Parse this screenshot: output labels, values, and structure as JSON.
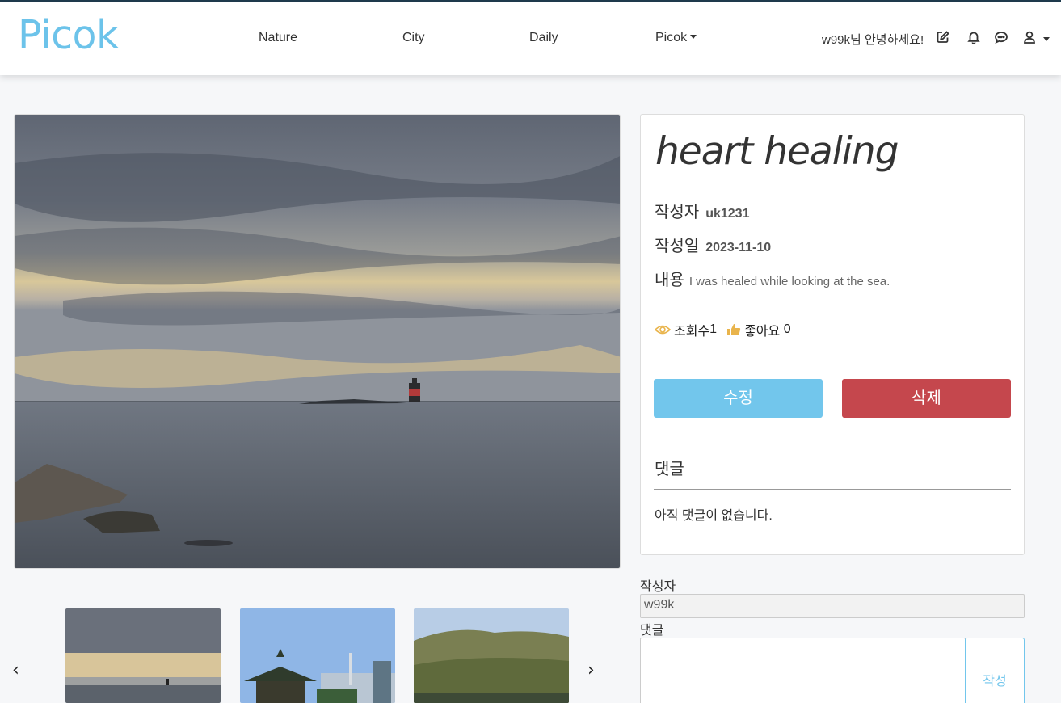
{
  "header": {
    "logo": "Picok",
    "nav": [
      "Nature",
      "City",
      "Daily",
      "Picok"
    ],
    "greeting": "w99k님 안녕하세요!",
    "icons": [
      "edit-icon",
      "bell-icon",
      "chat-icon",
      "user-icon"
    ]
  },
  "post": {
    "title": "heart healing",
    "author_label": "작성자",
    "author": "uk1231",
    "date_label": "작성일",
    "date": "2023-11-10",
    "content_label": "내용",
    "content": "I was healed while looking at the sea.",
    "views_label": "조회수",
    "views": "1",
    "likes_label": "좋아요",
    "likes": "0",
    "edit_button": "수정",
    "delete_button": "삭제",
    "comments_heading": "댓글",
    "no_comments": "아직 댓글이 없습니다."
  },
  "comment_form": {
    "author_label": "작성자",
    "author_value": "w99k",
    "comment_label": "댓글",
    "submit": "작성"
  },
  "carousel": {
    "thumbs": [
      "sunset-sea-lighthouse",
      "pagoda-city",
      "forest-lake"
    ],
    "prev_icon": "chevron-left-icon",
    "next_icon": "chevron-right-icon"
  },
  "colors": {
    "brand": "#6cc3ea",
    "edit": "#72c6ec",
    "delete": "#c5474d",
    "icon_accent": "#e9b44c"
  }
}
